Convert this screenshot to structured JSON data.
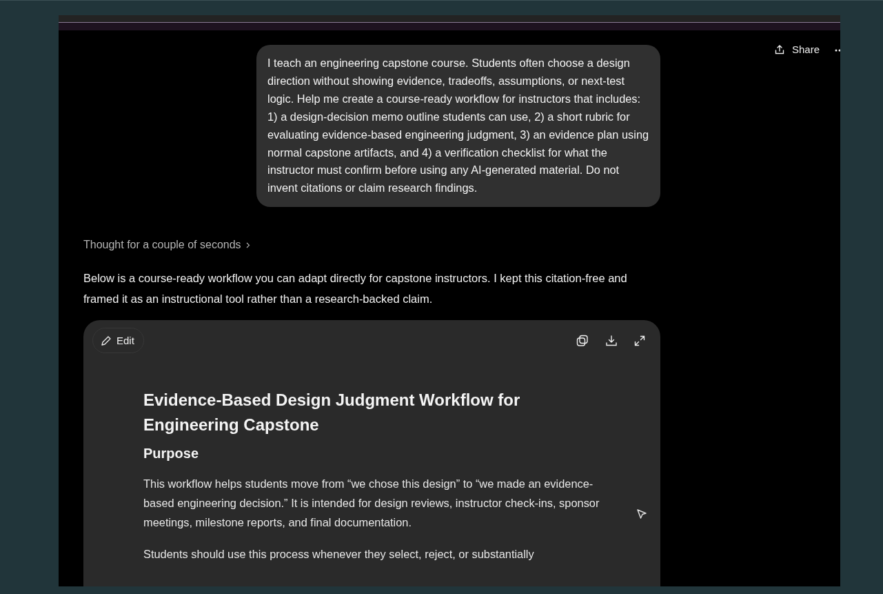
{
  "header": {
    "share_label": "Share"
  },
  "user_message": "I teach an engineering capstone course. Students often choose a design direction without showing evidence, tradeoffs, assumptions, or next-test logic. Help me create a course-ready workflow for instructors that includes: 1) a design-decision memo outline students can use, 2) a short rubric for evaluating evidence-based engineering judgment, 3) an evidence plan using normal capstone artifacts, and 4) a verification checklist for what the instructor must confirm before using any AI-generated material. Do not invent citations or claim research findings.",
  "thought": "Thought for a couple of seconds",
  "response": "Below is a course-ready workflow you can adapt directly for capstone instructors. I kept this citation-free and framed it as an instructional tool rather than a research-backed claim.",
  "canvas": {
    "edit_label": "Edit",
    "title": "Evidence-Based Design Judgment Workflow for Engineering Capstone",
    "sections": [
      {
        "heading": "Purpose",
        "paragraphs": [
          "This workflow helps students move from “we chose this design” to “we made an evidence-based engineering decision.” It is intended for design reviews, instructor check-ins, sponsor meetings, milestone reports, and final documentation.",
          "Students should use this process whenever they select, reject, or substantially"
        ]
      }
    ]
  }
}
